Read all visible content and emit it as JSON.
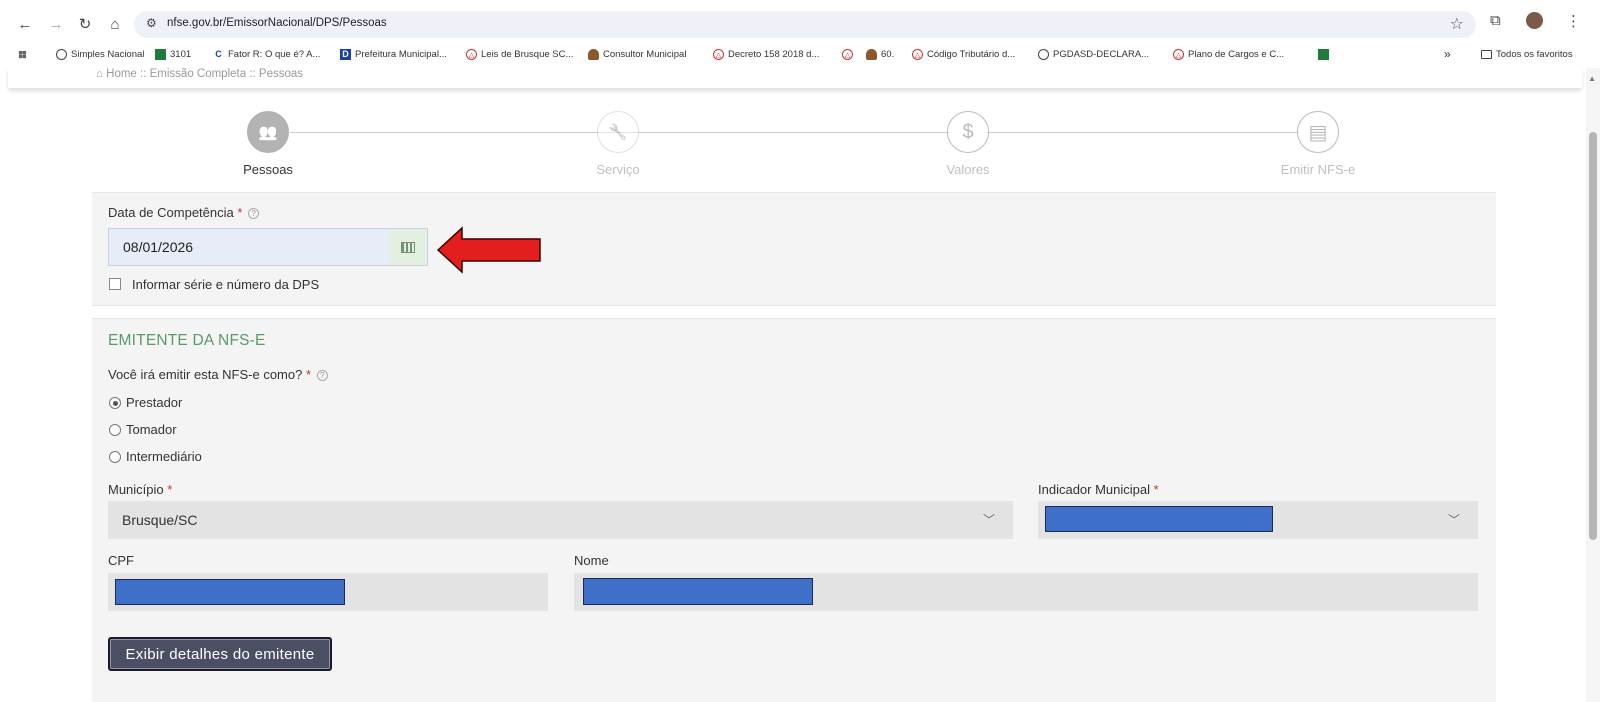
{
  "browser": {
    "url": "nfse.gov.br/EmissorNacional/DPS/Pessoas",
    "bookmarks": [
      {
        "label": "Simples Nacional",
        "icon": "globe-icon"
      },
      {
        "label": "3101",
        "icon": "flag-icon"
      },
      {
        "label": "Fator R: O que é? A...",
        "icon": "c-logo-icon"
      },
      {
        "label": "Prefeitura Municipal...",
        "icon": "d-logo-icon"
      },
      {
        "label": "Leis de Brusque SC...",
        "icon": "seal-icon"
      },
      {
        "label": "Consultor Municipal",
        "icon": "person-icon"
      },
      {
        "label": "Decreto 158 2018 d...",
        "icon": "seal-icon"
      },
      {
        "label": "",
        "icon": "seal-icon"
      },
      {
        "label": "60.",
        "icon": "person-icon"
      },
      {
        "label": "Código Tributário d...",
        "icon": "seal-icon"
      },
      {
        "label": "PGDASD-DECLARA...",
        "icon": "globe-icon"
      },
      {
        "label": "Plano de Cargos e C...",
        "icon": "seal-icon"
      },
      {
        "label": "",
        "icon": "flag-icon"
      }
    ],
    "more_bookmarks": "»",
    "all_bookmarks": "Todos os favoritos"
  },
  "breadcrumb": "Home :: Emissão Completa :: Pessoas",
  "steps": [
    {
      "label": "Pessoas",
      "icon": "people-icon",
      "active": true
    },
    {
      "label": "Serviço",
      "icon": "wrench-icon",
      "active": false
    },
    {
      "label": "Valores",
      "icon": "dollar-icon",
      "active": false
    },
    {
      "label": "Emitir NFS-e",
      "icon": "document-icon",
      "active": false
    }
  ],
  "form": {
    "data_competencia_label": "Data de Competência",
    "required_mark": "*",
    "data_competencia_value": "08/01/2026",
    "informar_serie_label": "Informar série e número da DPS",
    "emitente_title": "EMITENTE DA NFS-E",
    "emitir_como_label": "Você irá emitir esta NFS-e como?",
    "options": [
      {
        "label": "Prestador",
        "checked": true
      },
      {
        "label": "Tomador",
        "checked": false
      },
      {
        "label": "Intermediário",
        "checked": false
      }
    ],
    "municipio_label": "Município",
    "municipio_value": "Brusque/SC",
    "indicador_label": "Indicador Municipal",
    "cpf_label": "CPF",
    "nome_label": "Nome",
    "exibir_button": "Exibir detalhes do emitente"
  },
  "colors": {
    "active_step": "#2c3a7a",
    "section_title": "#5a9a6a",
    "redaction": "#3e6fc9",
    "arrow": "#e31e1e"
  }
}
